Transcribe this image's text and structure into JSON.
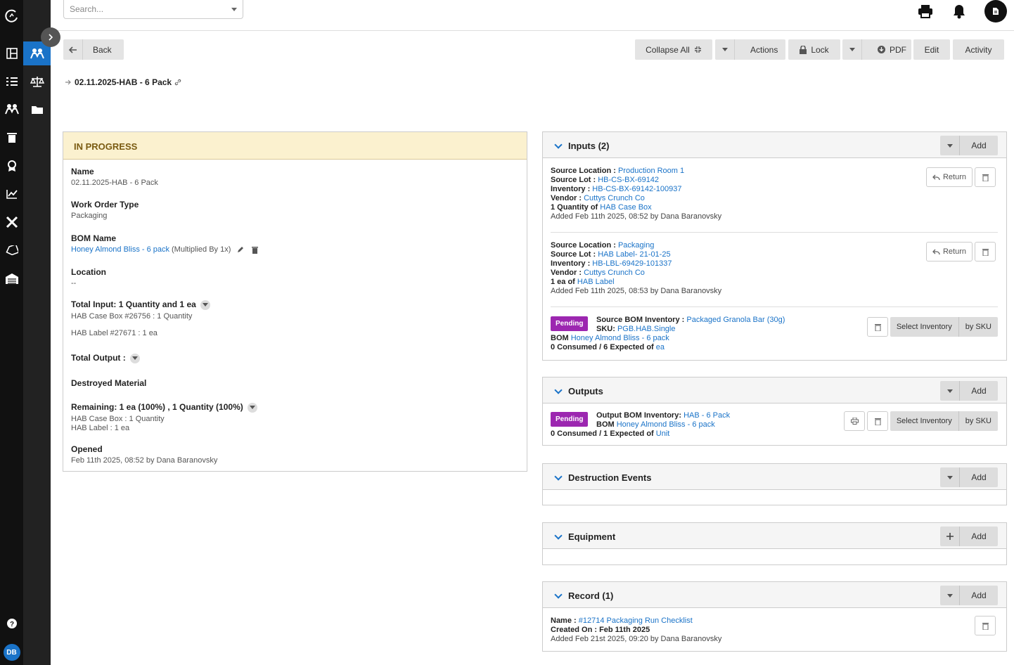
{
  "topbar": {
    "search_placeholder": "Search...",
    "avatar_label": "DB"
  },
  "toolbar": {
    "back": "Back",
    "collapse_all": "Collapse All",
    "actions": "Actions",
    "lock": "Lock",
    "pdf": "PDF",
    "edit": "Edit",
    "activity": "Activity"
  },
  "page": {
    "title": "02.11.2025-HAB - 6 Pack"
  },
  "status": "IN PROGRESS",
  "details": {
    "name_label": "Name",
    "name": "02.11.2025-HAB - 6 Pack",
    "wot_label": "Work Order Type",
    "wot": "Packaging",
    "bom_label": "BOM Name",
    "bom": "Honey Almond Bliss - 6 pack",
    "bom_mult": "(Multiplied By 1x)",
    "loc_label": "Location",
    "loc": "--",
    "ti_label": "Total Input: 1 Quantity and 1 ea",
    "ti_1": "HAB Case Box #26756 : 1 Quantity",
    "ti_2": "HAB Label #27671 : 1 ea",
    "to_label": "Total Output :",
    "dm_label": "Destroyed Material",
    "rem_label": "Remaining: 1 ea (100%) , 1 Quantity (100%)",
    "rem_1": "HAB Case Box : 1 Quantity",
    "rem_2": "HAB Label : 1 ea",
    "op_label": "Opened",
    "op": "Feb 11th 2025, 08:52 by Dana Baranovsky"
  },
  "inputs": {
    "title": "Inputs (2)",
    "add": "Add",
    "i1": {
      "sl_k": "Source Location :",
      "sl": "Production Room 1",
      "lot_k": "Source Lot :",
      "lot": "HB-CS-BX-69142",
      "inv_k": "Inventory :",
      "inv": "HB-CS-BX-69142-100937",
      "ven_k": "Vendor :",
      "ven": "Cuttys Crunch Co",
      "qty_k": "1 Quantity of",
      "qty": "HAB Case Box",
      "added": "Added Feb 11th 2025, 08:52 by Dana Baranovsky",
      "ret": "Return"
    },
    "i2": {
      "sl_k": "Source Location :",
      "sl": "Packaging",
      "lot_k": "Source Lot :",
      "lot": "HAB Label- 21-01-25",
      "inv_k": "Inventory :",
      "inv": "HB-LBL-69429-101337",
      "ven_k": "Vendor :",
      "ven": "Cuttys Crunch Co",
      "qty_k": "1 ea of",
      "qty": "HAB Label",
      "added": "Added Feb 11th 2025, 08:53 by Dana Baranovsky",
      "ret": "Return"
    },
    "p": {
      "badge": "Pending",
      "sbi_k": "Source BOM Inventory :",
      "sbi": "Packaged Granola Bar (30g)",
      "sku_k": "SKU:",
      "sku": "PGB.HAB.Single",
      "bom_k": "BOM",
      "bom": "Honey Almond Bliss - 6 pack",
      "cons_k": "0 Consumed / 6 Expected of",
      "cons": "ea",
      "sel": "Select Inventory",
      "sku_btn": "by SKU"
    }
  },
  "outputs": {
    "title": "Outputs",
    "add": "Add",
    "badge": "Pending",
    "obi_k": "Output BOM Inventory:",
    "obi": "HAB - 6 Pack",
    "bom_k": "BOM",
    "bom": "Honey Almond Bliss - 6 pack",
    "cons_k": "0 Consumed / 1 Expected of",
    "cons": "Unit",
    "sel": "Select Inventory",
    "sku_btn": "by SKU"
  },
  "destruction": {
    "title": "Destruction Events",
    "add": "Add"
  },
  "equipment": {
    "title": "Equipment",
    "add": "Add"
  },
  "record": {
    "title": "Record (1)",
    "add": "Add",
    "name_k": "Name :",
    "name": "#12714 Packaging Run Checklist",
    "created": "Created On : Feb 11th 2025",
    "added": "Added Feb 21st 2025, 09:20 by Dana Baranovsky"
  }
}
